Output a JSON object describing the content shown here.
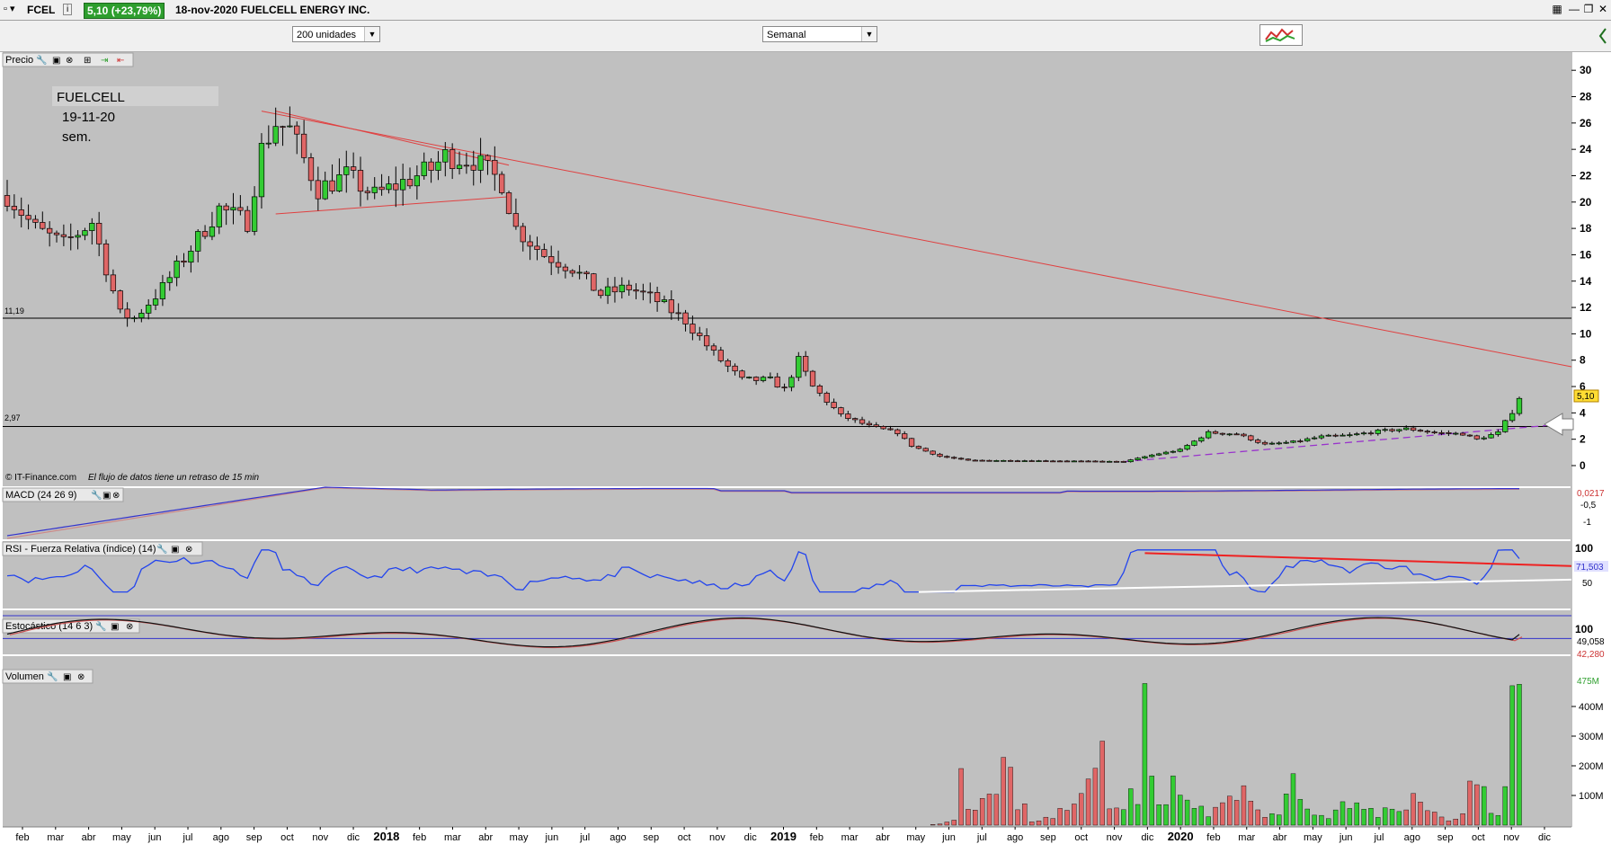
{
  "window": {
    "ticker": "FCEL",
    "price_badge": "5,10 (+23,79%)",
    "title": "18-nov-2020 FUELCELL ENERGY INC."
  },
  "toolbar": {
    "units_select": "200 unidades",
    "period_select": "Semanal"
  },
  "price_panel": {
    "label": "Precio",
    "annotation_lines": [
      "FUELCELL",
      "19-11-20",
      "sem."
    ],
    "copyright": "© IT-Finance.com",
    "delay_note": "El flujo de datos tiene un retraso de 15 min",
    "hline_labels": [
      "11,19",
      "2,97"
    ],
    "last_price_tag": "5,10",
    "y_ticks": [
      "30",
      "28",
      "26",
      "24",
      "22",
      "20",
      "18",
      "16",
      "14",
      "12",
      "10",
      "8",
      "6",
      "4",
      "2",
      "0"
    ]
  },
  "macd_panel": {
    "label": "MACD (24 26 9)",
    "value_tag": "0,0217",
    "y_ticks": [
      "-0,5",
      "-1"
    ]
  },
  "rsi_panel": {
    "label": "RSI - Fuerza Relativa (índice) (14)",
    "value_tag": "71,503",
    "y_ticks": [
      "100",
      "50"
    ]
  },
  "stoch_panel": {
    "label": "Estocástico (14 6 3)",
    "value_tags": [
      "49,058",
      "42,280"
    ],
    "y_ticks": [
      "100"
    ]
  },
  "volume_panel": {
    "label": "Volumen",
    "value_tag": "475M",
    "y_ticks": [
      "400M",
      "300M",
      "200M",
      "100M"
    ]
  },
  "x_axis_labels": [
    "feb",
    "mar",
    "abr",
    "may",
    "jun",
    "jul",
    "ago",
    "sep",
    "oct",
    "nov",
    "dic",
    "2018",
    "feb",
    "mar",
    "abr",
    "may",
    "jun",
    "jul",
    "ago",
    "sep",
    "oct",
    "nov",
    "dic",
    "2019",
    "feb",
    "mar",
    "abr",
    "may",
    "jun",
    "jul",
    "ago",
    "sep",
    "oct",
    "nov",
    "dic",
    "2020",
    "feb",
    "mar",
    "abr",
    "may",
    "jun",
    "jul",
    "ago",
    "sep",
    "oct",
    "nov",
    "dic"
  ],
  "colors": {
    "up_candle": "#33cc33",
    "down_candle": "#e06666",
    "chart_bg": "#c0c0c0",
    "trendline": "#e04040",
    "macd_line": "#3333cc",
    "rsi_line": "#2244ee",
    "support_dashed": "#9933cc"
  },
  "chart_data": {
    "type": "candlestick",
    "period": "weekly",
    "price_hlines": [
      11.19,
      2.97
    ],
    "last_close": 5.1,
    "price_ylim": [
      0,
      30
    ],
    "price_anchors": [
      [
        0,
        20.5
      ],
      [
        4,
        18
      ],
      [
        8,
        16.8
      ],
      [
        12,
        18.5
      ],
      [
        16,
        11.5
      ],
      [
        18,
        11.2
      ],
      [
        22,
        13.5
      ],
      [
        26,
        16.5
      ],
      [
        30,
        19.5
      ],
      [
        34,
        18.5
      ],
      [
        36,
        24
      ],
      [
        38,
        26
      ],
      [
        40,
        25.5
      ],
      [
        44,
        21
      ],
      [
        48,
        22
      ],
      [
        52,
        20.5
      ],
      [
        56,
        21.5
      ],
      [
        60,
        22.5
      ],
      [
        62,
        23.5
      ],
      [
        66,
        23.2
      ],
      [
        70,
        21.5
      ],
      [
        72,
        18
      ],
      [
        76,
        16
      ],
      [
        80,
        15
      ],
      [
        84,
        13
      ],
      [
        88,
        13.5
      ],
      [
        92,
        12.5
      ],
      [
        96,
        11
      ],
      [
        100,
        8.5
      ],
      [
        104,
        6.5
      ],
      [
        108,
        6.5
      ],
      [
        110,
        5.8
      ],
      [
        112,
        8
      ],
      [
        114,
        6
      ],
      [
        118,
        3.8
      ],
      [
        122,
        3
      ],
      [
        126,
        2.5
      ],
      [
        128,
        1.5
      ],
      [
        132,
        0.7
      ],
      [
        136,
        0.4
      ],
      [
        150,
        0.35
      ],
      [
        158,
        0.3
      ],
      [
        162,
        0.8
      ],
      [
        166,
        1.2
      ],
      [
        170,
        2.5
      ],
      [
        174,
        2.4
      ],
      [
        178,
        1.6
      ],
      [
        182,
        1.8
      ],
      [
        186,
        2.2
      ],
      [
        190,
        2.3
      ],
      [
        194,
        2.6
      ],
      [
        198,
        2.8
      ],
      [
        202,
        2.5
      ],
      [
        206,
        2.4
      ],
      [
        208,
        2.0
      ],
      [
        211,
        2.5
      ],
      [
        213,
        4.1
      ],
      [
        214,
        5.1
      ]
    ],
    "volume_millions_anchors": [
      [
        0,
        0.2
      ],
      [
        130,
        1
      ],
      [
        134,
        20
      ],
      [
        135,
        330
      ],
      [
        136,
        140
      ],
      [
        138,
        100
      ],
      [
        140,
        130
      ],
      [
        141,
        210
      ],
      [
        145,
        20
      ],
      [
        150,
        60
      ],
      [
        152,
        100
      ],
      [
        154,
        270
      ],
      [
        155,
        370
      ],
      [
        156,
        120
      ],
      [
        160,
        150
      ],
      [
        161,
        400
      ],
      [
        162,
        200
      ],
      [
        166,
        120
      ],
      [
        170,
        40
      ],
      [
        174,
        130
      ],
      [
        178,
        40
      ],
      [
        182,
        140
      ],
      [
        186,
        30
      ],
      [
        190,
        80
      ],
      [
        194,
        40
      ],
      [
        198,
        120
      ],
      [
        202,
        40
      ],
      [
        206,
        40
      ],
      [
        208,
        280
      ],
      [
        210,
        40
      ],
      [
        212,
        130
      ],
      [
        213,
        470
      ],
      [
        214,
        475
      ]
    ],
    "rsi_last": 71.503,
    "stoch_k_last": 49.058,
    "stoch_d_last": 42.28,
    "macd_last": 0.0217
  }
}
